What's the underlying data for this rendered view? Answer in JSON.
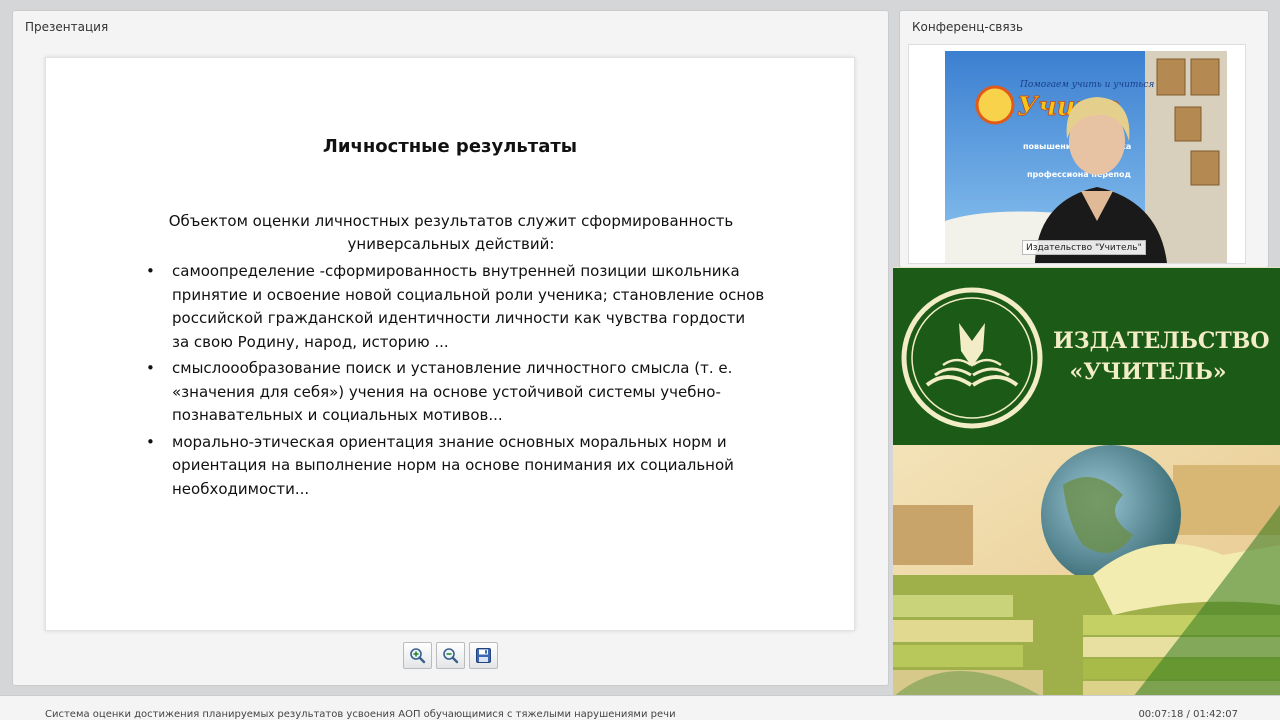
{
  "presentation_panel": {
    "title": "Презентация"
  },
  "slide": {
    "title": "Личностные результаты",
    "intro": "Объектом оценки личностных результатов служит сформированность универсальных действий:",
    "bullets": [
      "самоопределение -сформированность внутренней позиции школьника принятие и освоение новой социальной роли ученика; становление основ российской гражданской идентичности личности как чувства гордости за свою Родину, народ, историю ...",
      "смыслоообразование поиск и установление личностного смысла (т. е. «значения для себя») учения на основе устойчивой системы учебно-познавательных и социальных мотивов...",
      "морально-этическая ориентация знание основных моральных норм и ориентация на выполнение норм на основе понимания их социальной необходимости..."
    ],
    "bullet_char": "•"
  },
  "toolbar": {
    "zoom_in_icon": "zoom-in-icon",
    "zoom_out_icon": "zoom-out-icon",
    "save_icon": "floppy-disk-icon"
  },
  "conference_panel": {
    "title": "Конференц-связь",
    "video_caption": "Издательство \"Учитель\"",
    "banner_text": "Помогаем учить и учиться",
    "banner_word": "Учите",
    "banner_points": [
      "повышение квалифика",
      "профессиона перепод"
    ]
  },
  "brand": {
    "name_line1": "ИЗДАТЕЛЬСТВО",
    "name_line2": "«УЧИТЕЛЬ»"
  },
  "footer": {
    "title": "Система оценки достижения планируемых результатов усвоения АОП обучающимися с тяжелыми нарушениями речи",
    "time": "00:07:18 / 01:42:07"
  },
  "colors": {
    "brand_green": "#1c5a17",
    "brand_cream": "#f2edc6",
    "panel_bg": "#f4f4f4"
  }
}
